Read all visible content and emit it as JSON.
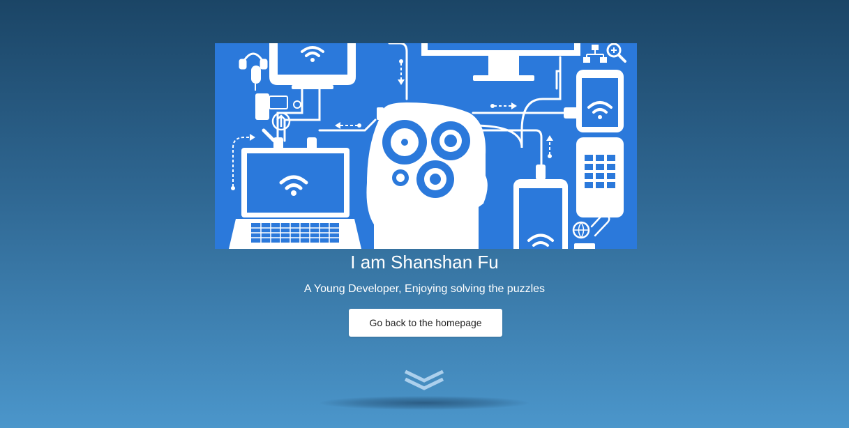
{
  "hero": {
    "title": "I am Shanshan Fu",
    "subtitle": "A Young Developer, Enjoying solving the puzzles",
    "button_label": "Go back to the homepage"
  },
  "icons": {
    "scroll": "double-chevron-down-icon",
    "illustration": "connected-devices-brain-illustration"
  },
  "colors": {
    "illustration_bg": "#2b79db",
    "gradient_top": "#1b4566",
    "gradient_bottom": "#4b96cb"
  }
}
